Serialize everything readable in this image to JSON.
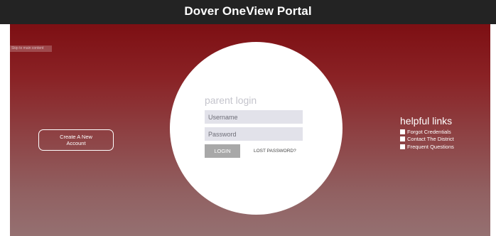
{
  "header": {
    "title": "Dover OneView Portal"
  },
  "skip_link": {
    "label": "Skip to main content"
  },
  "create_account": {
    "line1": "Create A New",
    "line2": "Account"
  },
  "login": {
    "title": "parent login",
    "username_placeholder": "Username",
    "password_placeholder": "Password",
    "login_button": "LOGIN",
    "lost_password": "LOST PASSWORD?"
  },
  "helpful_links": {
    "title": "helpful links",
    "items": [
      {
        "label": "Forgot Credentials",
        "icon": "checkbox-icon"
      },
      {
        "label": "Contact The District",
        "icon": "checkbox-icon"
      },
      {
        "label": "Frequent Questions",
        "icon": "checkbox-icon"
      }
    ]
  },
  "colors": {
    "header_bg": "#232323",
    "gradient_top": "#7d0f13",
    "gradient_bottom": "#957071",
    "circle": "#ffffff",
    "login_button": "#a8a8a8",
    "field_bg": "#e2e2ea"
  }
}
